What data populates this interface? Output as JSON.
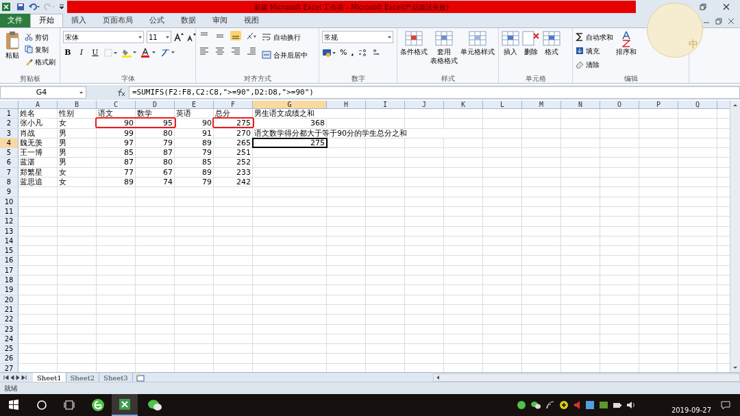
{
  "title_bar": {
    "title": "新建 Microsoft Excel 工作表 - Microsoft Excel(产品激活失败)"
  },
  "ribbon": {
    "file_tab": "文件",
    "tabs": [
      {
        "label": "开始",
        "selected": true
      },
      {
        "label": "插入",
        "selected": false
      },
      {
        "label": "页面布局",
        "selected": false
      },
      {
        "label": "公式",
        "selected": false
      },
      {
        "label": "数据",
        "selected": false
      },
      {
        "label": "审阅",
        "selected": false
      },
      {
        "label": "视图",
        "selected": false
      }
    ],
    "clipboard": {
      "paste": "粘贴",
      "cut": "剪切",
      "copy": "复制",
      "format_painter": "格式刷",
      "group": "剪贴板"
    },
    "font": {
      "name": "宋体",
      "size": "11",
      "bold": "B",
      "italic": "I",
      "underline": "U",
      "group": "字体"
    },
    "alignment": {
      "wrap": "自动换行",
      "merge": "合并后居中",
      "group": "对齐方式"
    },
    "number": {
      "format": "常规",
      "percent": "%",
      "comma": ",",
      "group": "数字"
    },
    "styles": {
      "conditional": "条件格式",
      "table_1": "套用",
      "table_2": "表格格式",
      "cell_styles": "单元格样式",
      "group": "样式"
    },
    "cells": {
      "insert": "插入",
      "delete": "删除",
      "format": "格式",
      "group": "单元格"
    },
    "editing": {
      "autosum": "自动求和",
      "fill": "填充",
      "clear": "清除",
      "sort": "排序和",
      "group": "编辑"
    }
  },
  "formula_bar": {
    "name_box": "G4",
    "formula": "=SUMIFS(F2:F8,C2:C8,\">=90\",D2:D8,\">=90\")"
  },
  "sheet": {
    "columns": [
      {
        "label": "A",
        "selected": false
      },
      {
        "label": "B",
        "selected": false
      },
      {
        "label": "C",
        "selected": false
      },
      {
        "label": "D",
        "selected": false
      },
      {
        "label": "E",
        "selected": false
      },
      {
        "label": "F",
        "selected": false
      },
      {
        "label": "G",
        "selected": true
      },
      {
        "label": "H",
        "selected": false
      },
      {
        "label": "I",
        "selected": false
      },
      {
        "label": "J",
        "selected": false
      },
      {
        "label": "K",
        "selected": false
      },
      {
        "label": "L",
        "selected": false
      },
      {
        "label": "M",
        "selected": false
      },
      {
        "label": "N",
        "selected": false
      },
      {
        "label": "O",
        "selected": false
      },
      {
        "label": "P",
        "selected": false
      },
      {
        "label": "Q",
        "selected": false
      }
    ],
    "rows": [
      {
        "header": "1",
        "selected": false,
        "cells": [
          "姓名",
          "性别",
          "语文",
          "数学",
          "英语",
          "总分",
          "男生语文成绩之和"
        ]
      },
      {
        "header": "2",
        "selected": false,
        "cells": [
          "张小凡",
          "女",
          {
            "text": "90",
            "circled": true
          },
          {
            "text": "95",
            "circled": true
          },
          "90",
          {
            "text": "275",
            "circled": true
          },
          "368"
        ]
      },
      {
        "header": "3",
        "selected": false,
        "cells": [
          "肖战",
          "男",
          "99",
          "80",
          "91",
          "270",
          "语文数学得分都大于等于90分的学生总分之和"
        ]
      },
      {
        "header": "4",
        "selected": true,
        "cells": [
          "魏无羡",
          "男",
          "97",
          "79",
          "89",
          "265",
          "275"
        ]
      },
      {
        "header": "5",
        "selected": false,
        "cells": [
          "王一博",
          "男",
          "85",
          "87",
          "79",
          "251"
        ]
      },
      {
        "header": "6",
        "selected": false,
        "cells": [
          "蓝湛",
          "男",
          "87",
          "80",
          "85",
          "252"
        ]
      },
      {
        "header": "7",
        "selected": false,
        "cells": [
          "郑繁星",
          "女",
          "77",
          "67",
          "89",
          "233"
        ]
      },
      {
        "header": "8",
        "selected": false,
        "cells": [
          "蓝思追",
          "女",
          "89",
          "74",
          "79",
          "242"
        ]
      },
      {
        "header": "9",
        "selected": false,
        "cells": []
      },
      {
        "header": "10",
        "selected": false,
        "cells": []
      },
      {
        "header": "11",
        "selected": false,
        "cells": []
      },
      {
        "header": "12",
        "selected": false,
        "cells": []
      },
      {
        "header": "13",
        "selected": false,
        "cells": []
      },
      {
        "header": "14",
        "selected": false,
        "cells": []
      },
      {
        "header": "15",
        "selected": false,
        "cells": []
      },
      {
        "header": "16",
        "selected": false,
        "cells": []
      },
      {
        "header": "17",
        "selected": false,
        "cells": []
      },
      {
        "header": "18",
        "selected": false,
        "cells": []
      },
      {
        "header": "19",
        "selected": false,
        "cells": []
      },
      {
        "header": "20",
        "selected": false,
        "cells": []
      },
      {
        "header": "21",
        "selected": false,
        "cells": []
      },
      {
        "header": "22",
        "selected": false,
        "cells": []
      },
      {
        "header": "23",
        "selected": false,
        "cells": []
      },
      {
        "header": "24",
        "selected": false,
        "cells": []
      },
      {
        "header": "25",
        "selected": false,
        "cells": []
      },
      {
        "header": "26",
        "selected": false,
        "cells": []
      },
      {
        "header": "27",
        "selected": false,
        "cells": []
      }
    ]
  },
  "sheet_tabs": [
    {
      "label": "Sheet1",
      "selected": true
    },
    {
      "label": "Sheet2",
      "selected": false
    },
    {
      "label": "Sheet3",
      "selected": false
    }
  ],
  "status_bar": {
    "status": "就绪"
  },
  "taskbar": {
    "date": "2019-09-27"
  },
  "floating_widget": {
    "label": "中"
  }
}
